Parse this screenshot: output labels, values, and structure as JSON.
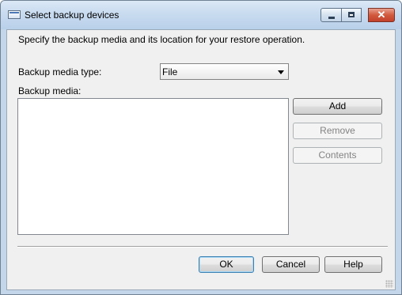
{
  "window": {
    "title": "Select backup devices",
    "close_glyph": "✕"
  },
  "description": "Specify the backup media and its location for your restore operation.",
  "media_type": {
    "label": "Backup media type:",
    "value": "File"
  },
  "media_list": {
    "label": "Backup media:",
    "items": []
  },
  "side_buttons": {
    "add": "Add",
    "remove": "Remove",
    "contents": "Contents"
  },
  "footer_buttons": {
    "ok": "OK",
    "cancel": "Cancel",
    "help": "Help"
  },
  "icons": {
    "title": "dialog-window-icon",
    "dropdown": "chevron-down-icon",
    "minimize": "minimize-icon",
    "maximize": "maximize-icon",
    "close": "close-icon",
    "grip": "resize-grip-icon"
  }
}
